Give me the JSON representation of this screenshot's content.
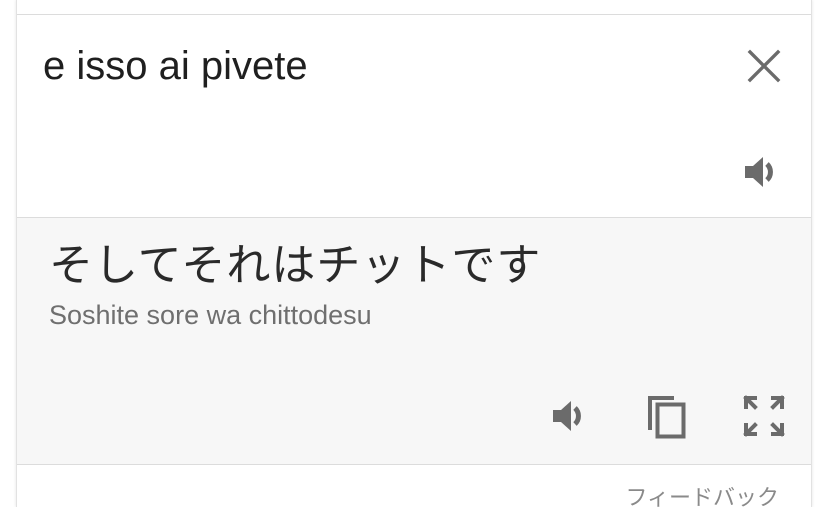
{
  "source": {
    "text": "e isso ai pivete",
    "clear_icon": "close-icon",
    "speaker_icon": "speaker-icon"
  },
  "result": {
    "translated_text": "そしてそれはチットです",
    "romanization": "Soshite sore wa chittodesu",
    "speaker_icon": "speaker-icon",
    "copy_icon": "copy-icon",
    "fullscreen_icon": "fullscreen-icon"
  },
  "footer": {
    "feedback_label": "フィードバック"
  },
  "colors": {
    "text_primary": "#1f1f1f",
    "text_secondary": "#6f6f6f",
    "icon": "#6b6b6b",
    "result_background": "#f7f7f7",
    "divider": "#dcdcdc"
  }
}
